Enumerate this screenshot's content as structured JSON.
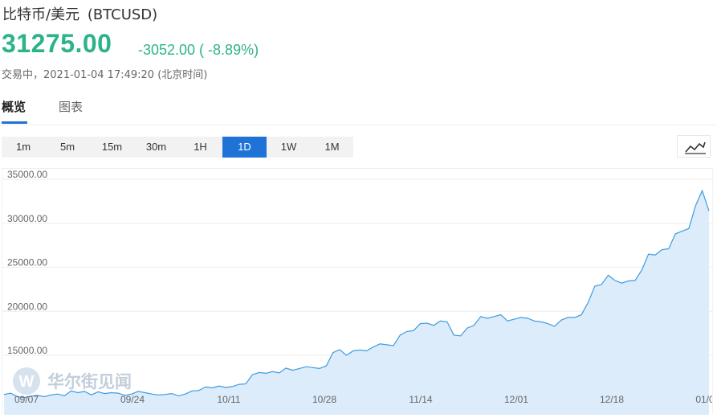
{
  "header": {
    "instrument_name": "比特币/美元",
    "symbol": "(BTCUSD)",
    "price": "31275.00",
    "change": "-3052.00 ( -8.89%)",
    "status": "交易中，2021-01-04 17:49:20 (北京时间)"
  },
  "tabs": [
    {
      "label": "概览",
      "active": true
    },
    {
      "label": "图表",
      "active": false
    }
  ],
  "periods": [
    {
      "label": "1m",
      "active": false
    },
    {
      "label": "5m",
      "active": false
    },
    {
      "label": "15m",
      "active": false
    },
    {
      "label": "30m",
      "active": false
    },
    {
      "label": "1H",
      "active": false
    },
    {
      "label": "1D",
      "active": true
    },
    {
      "label": "1W",
      "active": false
    },
    {
      "label": "1M",
      "active": false
    }
  ],
  "chart_type_icon": "line-chart-icon",
  "watermark": "华尔街见闻",
  "colors": {
    "accent_green": "#2cb38a",
    "active_blue": "#1f73d6",
    "line": "#3f9be0",
    "area": "#dcecfb"
  },
  "chart_data": {
    "type": "area",
    "title": "",
    "xlabel": "",
    "ylabel": "",
    "ylim": [
      10000,
      36000
    ],
    "y_ticks": [
      "15000.00",
      "20000.00",
      "25000.00",
      "30000.00",
      "35000.00"
    ],
    "x_ticks": [
      "09/07",
      "09/24",
      "10/11",
      "10/28",
      "11/14",
      "12/01",
      "12/18",
      "01/0"
    ],
    "series": [
      {
        "values": [
          10550,
          10700,
          10300,
          10200,
          10350,
          10450,
          10300,
          10500,
          10600,
          10400,
          10950,
          10750,
          10900,
          10500,
          10850,
          10650,
          10750,
          10700,
          10450,
          10600,
          10900,
          10750,
          10600,
          10500,
          10550,
          10650,
          10400,
          10600,
          10950,
          11000,
          11400,
          11300,
          11500,
          11350,
          11450,
          11700,
          11750,
          12800,
          13050,
          12950,
          13150,
          13000,
          13550,
          13300,
          13500,
          13700,
          13600,
          13500,
          13800,
          15300,
          15650,
          15000,
          15500,
          15600,
          15500,
          15950,
          16300,
          16200,
          16100,
          17300,
          17700,
          17800,
          18600,
          18650,
          18400,
          18900,
          18800,
          17300,
          17200,
          18100,
          18400,
          19400,
          19200,
          19400,
          19600,
          18900,
          19100,
          19300,
          19200,
          18900,
          18800,
          18600,
          18300,
          19000,
          19300,
          19300,
          19600,
          21000,
          22850,
          23050,
          24100,
          23500,
          23200,
          23450,
          23500,
          24700,
          26500,
          26400,
          27000,
          27100,
          28800,
          29100,
          29400,
          32000,
          33700,
          31400
        ]
      }
    ]
  }
}
